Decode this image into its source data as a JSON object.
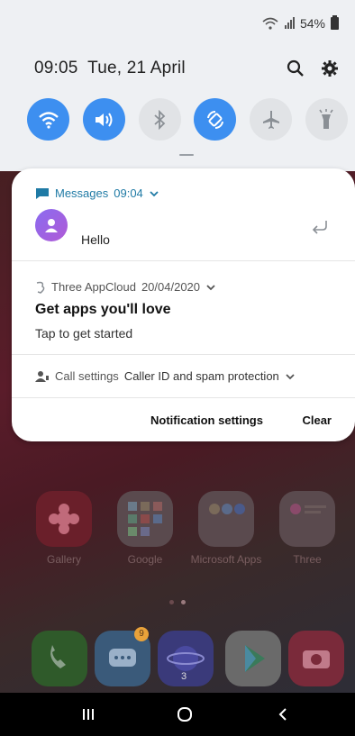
{
  "status_bar": {
    "battery": "54%"
  },
  "header": {
    "time": "09:05",
    "date": "Tue, 21 April"
  },
  "quick_settings": [
    {
      "name": "wifi",
      "state": "on"
    },
    {
      "name": "sound",
      "state": "on"
    },
    {
      "name": "bluetooth",
      "state": "off"
    },
    {
      "name": "auto-rotate",
      "state": "on"
    },
    {
      "name": "airplane-mode",
      "state": "off"
    },
    {
      "name": "flashlight",
      "state": "off"
    }
  ],
  "notifications": {
    "messages": {
      "app": "Messages",
      "time": "09:04",
      "text": "Hello"
    },
    "three": {
      "app": "Three AppCloud",
      "time": "20/04/2020",
      "title": "Get apps you'll love",
      "body": "Tap to get started"
    },
    "call": {
      "app": "Call settings",
      "text": "Caller ID and spam protection"
    }
  },
  "footer": {
    "notification_settings": "Notification settings",
    "clear": "Clear"
  },
  "home": {
    "apps": [
      {
        "label": "Gallery"
      },
      {
        "label": "Google"
      },
      {
        "label": "Microsoft Apps"
      },
      {
        "label": "Three"
      }
    ],
    "dock": {
      "messages_badge": "9",
      "internet_badge": "3"
    }
  },
  "colors": {
    "accent": "#3d8ff0",
    "messages_blue": "#1f7aa5"
  }
}
